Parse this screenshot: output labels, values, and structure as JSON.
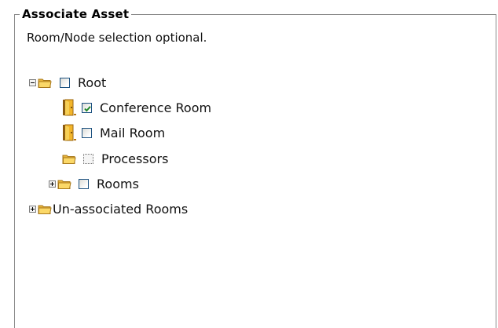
{
  "panel": {
    "title": "Associate Asset",
    "hint": "Room/Node selection optional."
  },
  "tree": {
    "root": {
      "label": "Root",
      "expanded": true,
      "checked": false
    },
    "children": [
      {
        "label": "Conference Room",
        "icon": "door-icon",
        "checked": true
      },
      {
        "label": "Mail Room",
        "icon": "door-icon",
        "checked": false
      },
      {
        "label": "Processors",
        "icon": "folder-icon",
        "checked": false,
        "disabled": true
      },
      {
        "label": "Rooms",
        "icon": "folder-icon",
        "checked": false,
        "expanded": false
      }
    ],
    "unassociated": {
      "label": "Un-associated Rooms",
      "expanded": false
    }
  },
  "colors": {
    "folder": "#f0c040",
    "door": "#e0a020",
    "checkmark": "#2a8a2a",
    "checkbox_border": "#1c5180"
  }
}
